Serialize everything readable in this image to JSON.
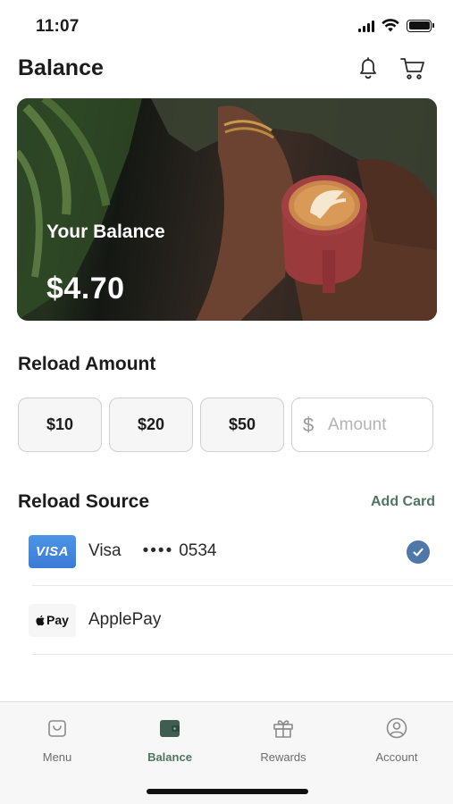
{
  "status_bar": {
    "time": "11:07"
  },
  "header": {
    "title": "Balance",
    "icons": [
      "bell-icon",
      "cart-icon"
    ]
  },
  "balance_card": {
    "label": "Your Balance",
    "amount": "$4.70"
  },
  "reload_amount": {
    "title": "Reload Amount",
    "options": [
      "$10",
      "$20",
      "$50"
    ],
    "input": {
      "prefix": "$",
      "placeholder": "Amount"
    }
  },
  "reload_source": {
    "title": "Reload Source",
    "add_card_label": "Add Card",
    "sources": [
      {
        "logo_text": "VISA",
        "name": "Visa",
        "mask": "••••",
        "last4": "0534",
        "selected": true
      },
      {
        "logo_text": "Pay",
        "name": "ApplePay",
        "selected": false
      }
    ]
  },
  "tab_bar": {
    "tabs": [
      {
        "label": "Menu",
        "icon": "bag-icon",
        "active": false
      },
      {
        "label": "Balance",
        "icon": "wallet-icon",
        "active": true
      },
      {
        "label": "Rewards",
        "icon": "gift-icon",
        "active": false
      },
      {
        "label": "Account",
        "icon": "user-icon",
        "active": false
      }
    ]
  },
  "colors": {
    "accent": "#4f7563",
    "check": "#4f78a8",
    "visa": "#3a7bd5"
  }
}
